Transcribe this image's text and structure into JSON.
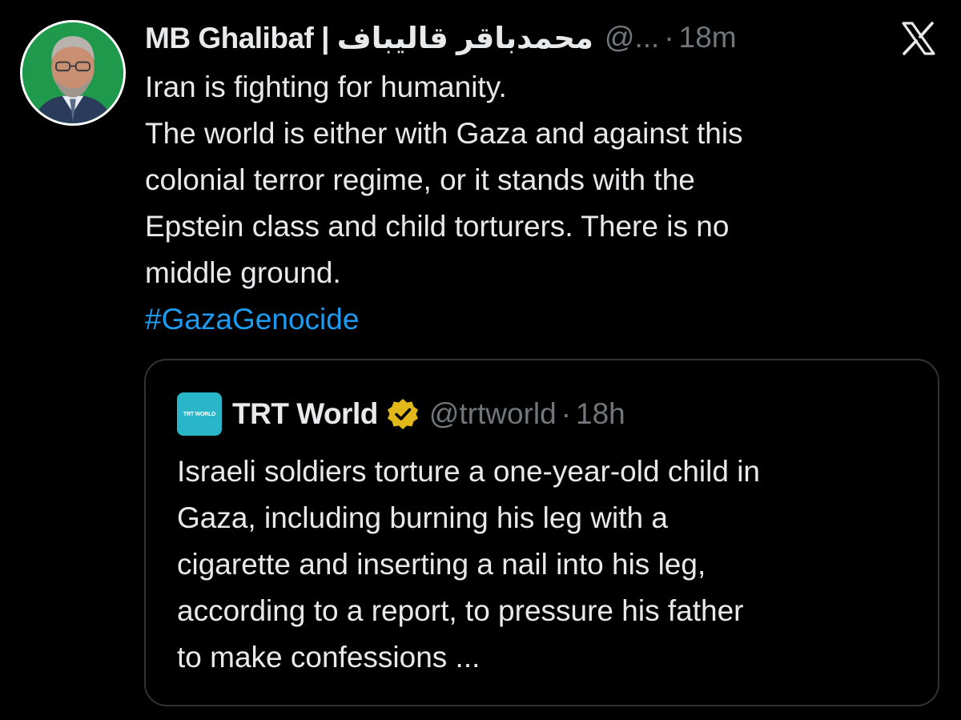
{
  "tweet": {
    "author_name": "MB Ghalibaf | محمدباقر قالیباف",
    "handle": "@...",
    "separator": "·",
    "time": "18m",
    "text_lines": [
      "Iran is fighting for humanity.",
      "The world is either with Gaza and against this",
      "colonial terror regime, or it stands with the",
      "Epstein class and child torturers. There is no",
      "middle ground."
    ],
    "hashtag": "#GazaGenocide"
  },
  "quoted_tweet": {
    "avatar_text": "TRT WORLD",
    "author_name": "TRT World",
    "handle": "@trtworld",
    "separator": "·",
    "time": "18h",
    "text_lines": [
      "Israeli soldiers torture a one-year-old child in",
      "Gaza, including burning his leg with a",
      "cigarette and inserting a nail into his leg,",
      "according to a report, to pressure his father",
      "to make confessions ..."
    ]
  },
  "icons": {
    "brand": "x-logo-icon",
    "verified": "verified-badge-icon"
  },
  "colors": {
    "background": "#000000",
    "text": "#e7e9ea",
    "muted": "#71767b",
    "link": "#1d9bf0",
    "border": "#2f3336",
    "verified_gold": "#e2b719",
    "trt_teal": "#29b6c8"
  }
}
